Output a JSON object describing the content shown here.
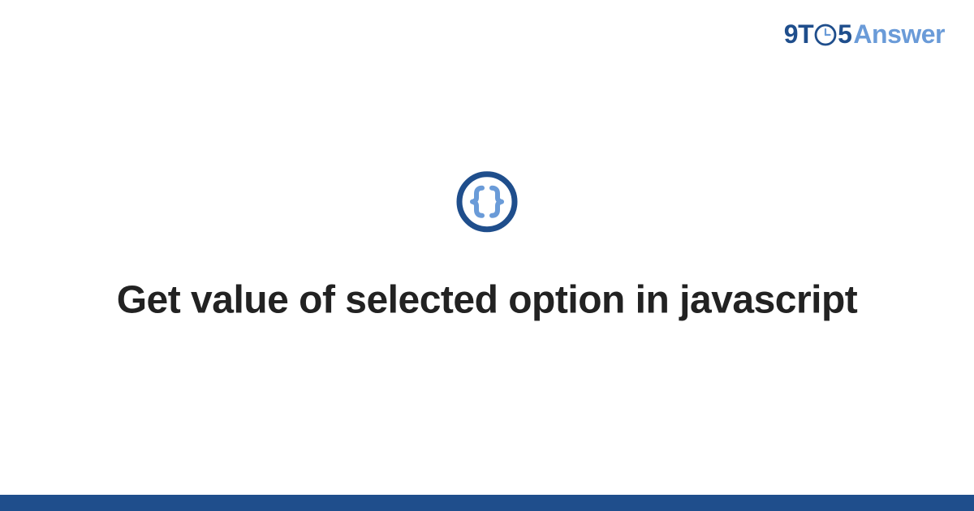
{
  "brand": {
    "part1": "9T",
    "part2": "5",
    "part3": "Answer"
  },
  "main": {
    "icon_name": "braces-icon",
    "title": "Get value of selected option in javascript"
  },
  "colors": {
    "brand_dark": "#1f4e8c",
    "brand_light": "#6a9bd8",
    "text": "#222222"
  }
}
